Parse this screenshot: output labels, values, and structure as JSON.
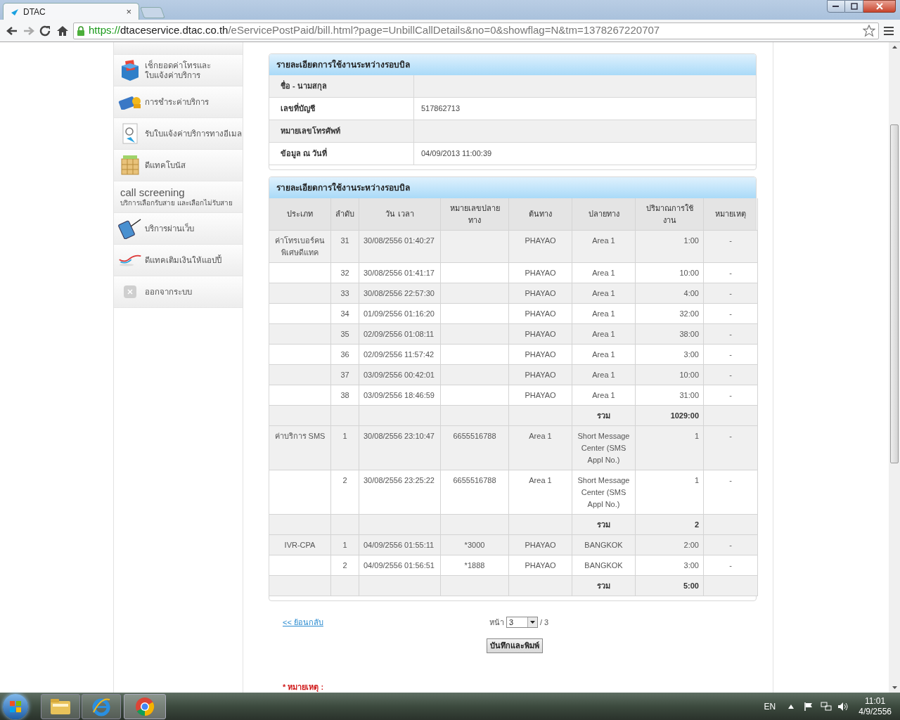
{
  "browser": {
    "tab_title": "DTAC",
    "tab_close": "×",
    "url_scheme": "https://",
    "url_host": "dtaceservice.dtac.co.th",
    "url_path": "/eServicePostPaid/bill.html?page=UnbillCallDetails&no=0&showflag=N&tm=1378267220707"
  },
  "sidebar": {
    "items": [
      {
        "kind": "icon",
        "label": "เช็กยอดค่าโทรและ\nใบแจ้งค่าบริการ"
      },
      {
        "kind": "icon",
        "label": "การชำระค่าบริการ"
      },
      {
        "kind": "icon",
        "label": "รับใบแจ้งค่าบริการทางอีเมล"
      },
      {
        "kind": "icon",
        "label": "ดีแทคโบนัส"
      },
      {
        "kind": "text",
        "title": "call screening",
        "label": "บริการเลือกรับสาย และเลือกไม่รับสาย"
      },
      {
        "kind": "icon",
        "label": "บริการผ่านเว็บ"
      },
      {
        "kind": "icon",
        "label": "ดีแทคเติมเงินให้แอปปี้"
      },
      {
        "kind": "icon",
        "label": "ออกจากระบบ"
      }
    ]
  },
  "info_panel": {
    "title": "รายละเอียดการใช้งานระหว่างรอบบิล",
    "rows": [
      {
        "label": "ชื่อ - นามสกุล"
      },
      {
        "label": "เลขที่บัญชี",
        "value": "517862713"
      },
      {
        "label": "หมายเลขโทรศัพท์"
      },
      {
        "label": "ข้อมูล ณ วันที่",
        "value": "04/09/2013 11:00:39"
      }
    ]
  },
  "usage_table": {
    "title": "รายละเอียดการใช้งานระหว่างรอบบิล",
    "columns": [
      "ประเภท",
      "ลำดับ",
      "วัน เวลา",
      "หมายเลขปลายทาง",
      "ต้นทาง",
      "ปลายทาง",
      "ปริมาณการใช้งาน",
      "หมายเหตุ"
    ],
    "rows": [
      {
        "kind": "call",
        "type": "ค่าโทรเบอร์คนพิเศษดีแทค",
        "seq": "31",
        "datetime": "30/08/2556 01:40:27",
        "origin": "PHAYAO",
        "destination": "Area 1",
        "usage": "1:00",
        "note": "-"
      },
      {
        "kind": "call",
        "seq": "32",
        "datetime": "30/08/2556 01:41:17",
        "origin": "PHAYAO",
        "destination": "Area 1",
        "usage": "10:00",
        "note": "-"
      },
      {
        "kind": "call",
        "seq": "33",
        "datetime": "30/08/2556 22:57:30",
        "origin": "PHAYAO",
        "destination": "Area 1",
        "usage": "4:00",
        "note": "-"
      },
      {
        "kind": "call",
        "seq": "34",
        "datetime": "01/09/2556 01:16:20",
        "origin": "PHAYAO",
        "destination": "Area 1",
        "usage": "32:00",
        "note": "-"
      },
      {
        "kind": "call",
        "seq": "35",
        "datetime": "02/09/2556 01:08:11",
        "origin": "PHAYAO",
        "destination": "Area 1",
        "usage": "38:00",
        "note": "-"
      },
      {
        "kind": "call",
        "seq": "36",
        "datetime": "02/09/2556 11:57:42",
        "origin": "PHAYAO",
        "destination": "Area 1",
        "usage": "3:00",
        "note": "-"
      },
      {
        "kind": "call",
        "seq": "37",
        "datetime": "03/09/2556 00:42:01",
        "origin": "PHAYAO",
        "destination": "Area 1",
        "usage": "10:00",
        "note": "-"
      },
      {
        "kind": "call",
        "seq": "38",
        "datetime": "03/09/2556 18:46:59",
        "origin": "PHAYAO",
        "destination": "Area 1",
        "usage": "31:00",
        "note": "-"
      },
      {
        "kind": "total",
        "label": "รวม",
        "value": "1029:00"
      },
      {
        "kind": "call",
        "type": "ค่าบริการ SMS",
        "seq": "1",
        "datetime": "30/08/2556 23:10:47",
        "number": "6655516788",
        "origin": "Area 1",
        "destination": "Short Message Center (SMS Appl No.)",
        "usage": "1",
        "note": "-"
      },
      {
        "kind": "call",
        "seq": "2",
        "datetime": "30/08/2556 23:25:22",
        "number": "6655516788",
        "origin": "Area 1",
        "destination": "Short Message Center (SMS Appl No.)",
        "usage": "1",
        "note": "-"
      },
      {
        "kind": "total",
        "label": "รวม",
        "value": "2"
      },
      {
        "kind": "call",
        "type": "IVR-CPA",
        "seq": "1",
        "datetime": "04/09/2556 01:55:11",
        "number": "*3000",
        "origin": "PHAYAO",
        "destination": "BANGKOK",
        "usage": "2:00",
        "note": "-"
      },
      {
        "kind": "call",
        "seq": "2",
        "datetime": "04/09/2556 01:56:51",
        "number": "*1888",
        "origin": "PHAYAO",
        "destination": "BANGKOK",
        "usage": "3:00",
        "note": "-"
      },
      {
        "kind": "total",
        "label": "รวม",
        "value": "5:00"
      }
    ]
  },
  "footer": {
    "back_link": "<< ย้อนกลับ",
    "page_label": "หน้า",
    "page_value": "3",
    "page_total": "/ 3",
    "save_button": "บันทึกและพิมพ์",
    "remark": "* หมายเหตุ :"
  },
  "taskbar": {
    "language": "EN",
    "time": "11:01",
    "date": "4/9/2556"
  }
}
